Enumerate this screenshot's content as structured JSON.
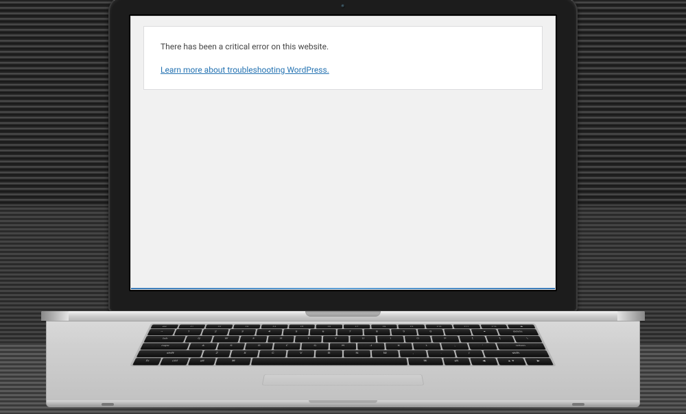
{
  "error": {
    "message": "There has been a critical error on this website.",
    "link_text": "Learn more about troubleshooting WordPress."
  },
  "keyboard": {
    "row0": [
      "esc",
      "F1",
      "F2",
      "F3",
      "F4",
      "F5",
      "F6",
      "F7",
      "F8",
      "F9",
      "F10",
      "F11",
      "F12",
      "⏏"
    ],
    "row1": [
      "~",
      "1",
      "2",
      "3",
      "4",
      "5",
      "6",
      "7",
      "8",
      "9",
      "0",
      "-",
      "=",
      "delete"
    ],
    "row2": [
      "tab",
      "Q",
      "W",
      "E",
      "R",
      "T",
      "Y",
      "U",
      "I",
      "O",
      "P",
      "[",
      "]",
      "\\"
    ],
    "row3": [
      "caps",
      "A",
      "S",
      "D",
      "F",
      "G",
      "H",
      "J",
      "K",
      "L",
      ";",
      "'",
      "return"
    ],
    "row4": [
      "shift",
      "Z",
      "X",
      "C",
      "V",
      "B",
      "N",
      "M",
      ",",
      ".",
      "/",
      "shift"
    ],
    "row5": [
      "fn",
      "ctrl",
      "alt",
      "⌘",
      "",
      "⌘",
      "alt",
      "◀",
      "▲▼",
      "▶"
    ]
  }
}
